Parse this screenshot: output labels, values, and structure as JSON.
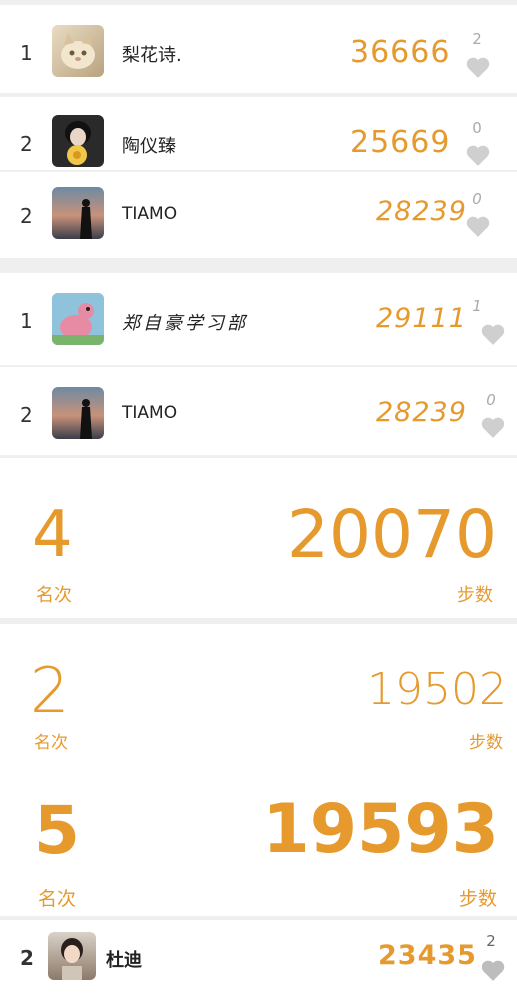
{
  "leaderboard_top": [
    {
      "rank": "1",
      "name": "梨花诗.",
      "steps": "36666",
      "likes": "2",
      "avatar": "cat-avatar"
    },
    {
      "rank": "2",
      "name": "陶仪臻",
      "steps": "25669",
      "likes": "0",
      "avatar": "girl-flower-avatar"
    },
    {
      "rank": "2",
      "name": "TIAMO",
      "steps": "28239",
      "likes": "0",
      "avatar": "sunset-silhouette-avatar"
    }
  ],
  "leaderboard_mid": [
    {
      "rank": "1",
      "name": "郑自豪学习部",
      "steps": "29111",
      "likes": "1",
      "avatar": "cartoon-avatar"
    },
    {
      "rank": "2",
      "name": "TIAMO",
      "steps": "28239",
      "likes": "0",
      "avatar": "sunset-silhouette-avatar"
    }
  ],
  "stat_cards": [
    {
      "rank": "4",
      "rank_label": "名次",
      "steps": "20070",
      "steps_label": "步数"
    },
    {
      "rank": "2",
      "rank_label": "名次",
      "steps": "19502",
      "steps_label": "步数"
    },
    {
      "rank": "5",
      "rank_label": "名次",
      "steps": "19593",
      "steps_label": "步数"
    }
  ],
  "leaderboard_bottom": [
    {
      "rank": "2",
      "name": "杜迪",
      "steps": "23435",
      "likes": "2",
      "avatar": "girl-avatar"
    }
  ],
  "colors": {
    "accent": "#e69a2e",
    "heart": "#cfcfcf",
    "text": "#222222"
  }
}
